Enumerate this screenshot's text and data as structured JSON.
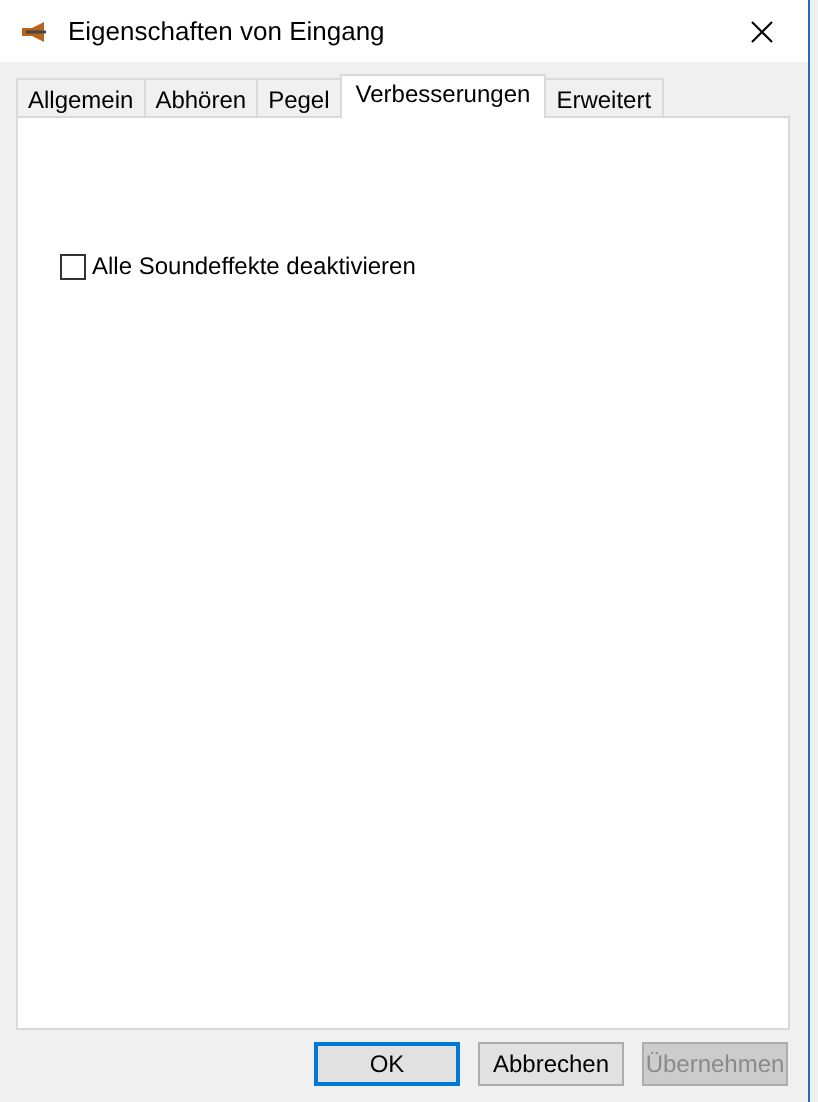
{
  "window": {
    "title": "Eigenschaften von Eingang"
  },
  "tabs": [
    {
      "label": "Allgemein",
      "selected": false
    },
    {
      "label": "Abhören",
      "selected": false
    },
    {
      "label": "Pegel",
      "selected": false
    },
    {
      "label": "Verbesserungen",
      "selected": true
    },
    {
      "label": "Erweitert",
      "selected": false
    }
  ],
  "options": [
    {
      "label": "Alle Soundeffekte deaktivieren",
      "checked": false
    }
  ],
  "buttons": [
    {
      "label": "OK",
      "default": true,
      "disabled": false
    },
    {
      "label": "Abbrechen",
      "default": false,
      "disabled": false
    },
    {
      "label": "Übernehmen",
      "default": false,
      "disabled": true
    }
  ]
}
